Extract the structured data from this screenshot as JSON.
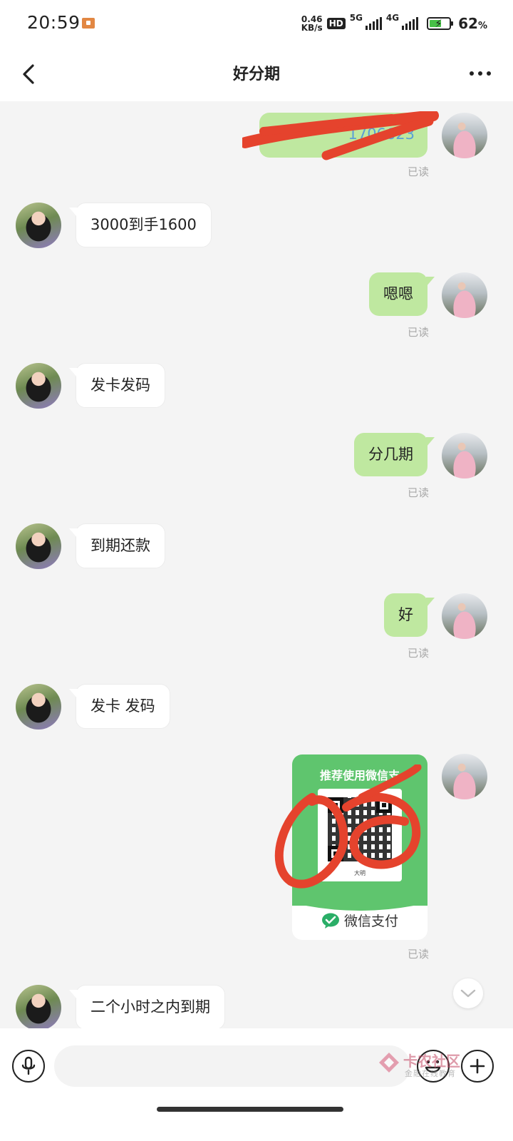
{
  "status_bar": {
    "time": "20:59",
    "speed_value": "0.46",
    "speed_unit": "KB/s",
    "hd_badge": "HD",
    "net_5g": "5G",
    "net_4g": "4G",
    "battery_percent": "62",
    "battery_unit": "%",
    "battery_level": 0.62,
    "battery_color": "#48c048"
  },
  "nav": {
    "back_icon": "chevron-left-icon",
    "title": "好分期",
    "more_icon": "more-horizontal-icon"
  },
  "chat": {
    "read_label": "已读",
    "messages": [
      {
        "from": "me",
        "text": "1706623",
        "redacted": true
      },
      {
        "from": "other",
        "text": "3000到手1600"
      },
      {
        "from": "me",
        "text": "嗯嗯"
      },
      {
        "from": "other",
        "text": "发卡发码"
      },
      {
        "from": "me",
        "text": "分几期"
      },
      {
        "from": "other",
        "text": "到期还款"
      },
      {
        "from": "me",
        "text": "好"
      },
      {
        "from": "other",
        "text": "发卡 发码"
      },
      {
        "from": "me",
        "type": "payment-card",
        "card_title": "推荐使用微信支",
        "qr_caption": "大明",
        "footer_label": "微信支付",
        "brand_color": "#5fc56e"
      },
      {
        "from": "other",
        "text": "二个小时之内到期"
      }
    ]
  },
  "input_bar": {
    "placeholder": "",
    "voice_icon": "microphone-icon",
    "emoji_icon": "emoji-icon",
    "add_icon": "plus-icon",
    "watermark_main": "卡农社区",
    "watermark_sub": "金融在线教育"
  },
  "colors": {
    "bubble_me": "#bfe8a0",
    "bubble_other": "#ffffff",
    "background": "#f4f4f4",
    "redaction": "#e5432d"
  }
}
